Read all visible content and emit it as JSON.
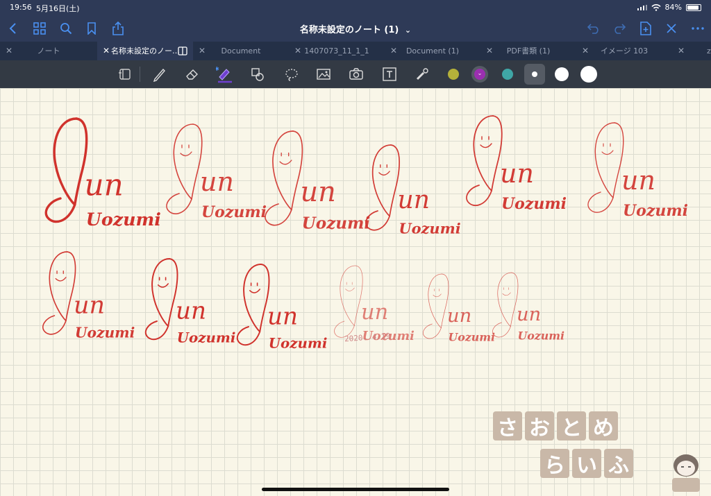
{
  "status_bar": {
    "time": "19:56",
    "date": "5月16日(土)",
    "battery": "84%",
    "battery_level": 0.84
  },
  "header": {
    "title": "名称未設定のノート (1)",
    "title_chevron": "⌄"
  },
  "tabs": [
    {
      "label": "ノート",
      "active": false
    },
    {
      "label": "名称未設定のノー…",
      "active": true
    },
    {
      "label": "Document",
      "active": false
    },
    {
      "label": "1407073_11_1_1",
      "active": false
    },
    {
      "label": "Document (1)",
      "active": false
    },
    {
      "label": "PDF書類 (1)",
      "active": false
    },
    {
      "label": "イメージ 103",
      "active": false
    },
    {
      "label": "z",
      "active": false
    }
  ],
  "tools": [
    {
      "name": "page-layout-icon"
    },
    {
      "name": "pen-icon"
    },
    {
      "name": "eraser-icon"
    },
    {
      "name": "highlighter-icon"
    },
    {
      "name": "shapes-icon"
    },
    {
      "name": "lasso-icon"
    },
    {
      "name": "image-icon"
    },
    {
      "name": "camera-icon"
    },
    {
      "name": "text-icon"
    },
    {
      "name": "laser-pointer-icon"
    }
  ],
  "colors": {
    "yellow": "#b5b13a",
    "purple": "#9b2fb0",
    "teal": "#3fa6a6",
    "accent": "#4a90f0",
    "ink": "#d0322c"
  },
  "signature_text": {
    "first": "Jun",
    "last": "Uozumi"
  },
  "date_note": "2020. 4.19",
  "watermark": [
    "さ",
    "お",
    "と",
    "め",
    "ら",
    "い",
    "ふ"
  ]
}
